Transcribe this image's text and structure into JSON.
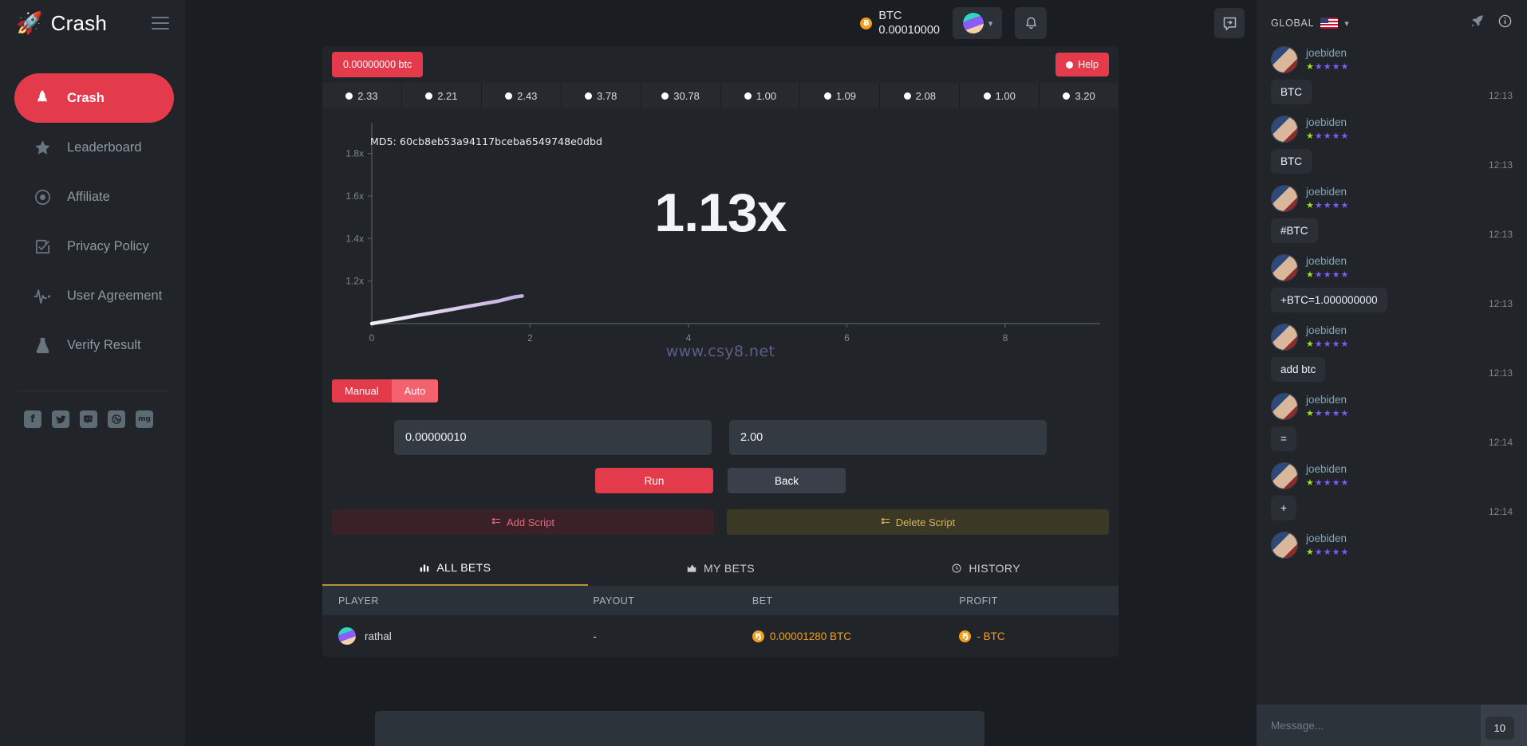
{
  "brand": {
    "name": "Crash",
    "rocket_icon": "rocket-icon"
  },
  "sidebar": {
    "items": [
      {
        "label": "Crash",
        "icon": "rocket-icon",
        "active": true
      },
      {
        "label": "Leaderboard",
        "icon": "star-icon",
        "active": false
      },
      {
        "label": "Affiliate",
        "icon": "target-icon",
        "active": false
      },
      {
        "label": "Privacy Policy",
        "icon": "checkbox-icon",
        "active": false
      },
      {
        "label": "User Agreement",
        "icon": "pulse-icon",
        "active": false
      },
      {
        "label": "Verify Result",
        "icon": "flask-icon",
        "active": false
      }
    ],
    "socials": [
      {
        "name": "facebook-icon",
        "glyph": "f"
      },
      {
        "name": "twitter-icon",
        "glyph": "✈"
      },
      {
        "name": "discord-icon",
        "glyph": "●●"
      },
      {
        "name": "dribbble-icon",
        "glyph": "◎"
      },
      {
        "name": "mg-icon",
        "glyph": "mg"
      }
    ]
  },
  "topbar": {
    "currency": "BTC",
    "balance": "0.00010000",
    "coin_symbol": "Ƀ",
    "avatar_icon": "avatar",
    "chevron_icon": "chevron-down-icon",
    "bell_icon": "bell-icon",
    "chat_toggle_icon": "chat-collapse-icon"
  },
  "game": {
    "amount_badge": "0.00000000 btc",
    "help_label": "Help",
    "history": [
      "2.33",
      "2.21",
      "2.43",
      "3.78",
      "30.78",
      "1.00",
      "1.09",
      "2.08",
      "1.00",
      "3.20"
    ],
    "md5_label": "MD5: 60cb8eb53a94117bceba6549748e0dbd",
    "multiplier": "1.13x",
    "watermark": "www.csy8.net",
    "mode_manual": "Manual",
    "mode_auto": "Auto",
    "bet_amount": "0.00000010",
    "auto_cashout": "2.00",
    "run_label": "Run",
    "back_label": "Back",
    "add_script_label": "Add Script",
    "delete_script_label": "Delete Script"
  },
  "chart_data": {
    "type": "line",
    "title": "MD5: 60cb8eb53a94117bceba6549748e0dbd",
    "xlabel": "",
    "ylabel": "",
    "xlim": [
      0,
      9.2
    ],
    "ylim": [
      1.0,
      1.9
    ],
    "grid": false,
    "legend": "none",
    "xticks": [
      "0",
      "2",
      "4",
      "6",
      "8"
    ],
    "xtick_values": [
      0,
      2,
      4,
      6,
      8
    ],
    "yticks": [
      "1.2x",
      "1.4x",
      "1.6x",
      "1.8x"
    ],
    "ytick_values": [
      1.2,
      1.4,
      1.6,
      1.8
    ],
    "series": [
      {
        "name": "multiplier",
        "color": "#d9c7ee",
        "x": [
          0,
          0.2,
          0.4,
          0.6,
          0.8,
          1.0,
          1.2,
          1.4,
          1.6,
          1.8,
          1.9
        ],
        "y": [
          1.0,
          1.013,
          1.026,
          1.04,
          1.053,
          1.066,
          1.08,
          1.093,
          1.106,
          1.125,
          1.13
        ]
      }
    ]
  },
  "tabs": [
    {
      "label": "ALL BETS",
      "icon": "bar-chart-icon",
      "active": true
    },
    {
      "label": "MY BETS",
      "icon": "chart-icon",
      "active": false
    },
    {
      "label": "HISTORY",
      "icon": "clock-icon",
      "active": false
    }
  ],
  "table": {
    "columns": [
      "PLAYER",
      "PAYOUT",
      "BET",
      "PROFIT"
    ],
    "rows": [
      {
        "player": "rathal",
        "payout": "-",
        "bet": "0.00001280 BTC",
        "profit": "- BTC"
      }
    ]
  },
  "chat": {
    "channel": "GLOBAL",
    "flag_icon": "us-flag-icon",
    "chevron_icon": "chevron-down-icon",
    "rocket_icon": "rocket-icon",
    "info_icon": "info-icon",
    "unread_count": "10",
    "input_placeholder": "Message...",
    "send_icon": "send-icon",
    "messages": [
      {
        "user": "joebiden",
        "text": "BTC",
        "time": "12:13"
      },
      {
        "user": "joebiden",
        "text": "BTC",
        "time": "12:13"
      },
      {
        "user": "joebiden",
        "text": "#BTC",
        "time": "12:13"
      },
      {
        "user": "joebiden",
        "text": "+BTC=1.000000000",
        "time": "12:13"
      },
      {
        "user": "joebiden",
        "text": "add btc",
        "time": "12:13"
      },
      {
        "user": "joebiden",
        "text": "=",
        "time": "12:14"
      },
      {
        "user": "joebiden",
        "text": "+",
        "time": "12:14"
      },
      {
        "user": "joebiden",
        "text": "",
        "time": ""
      }
    ]
  }
}
